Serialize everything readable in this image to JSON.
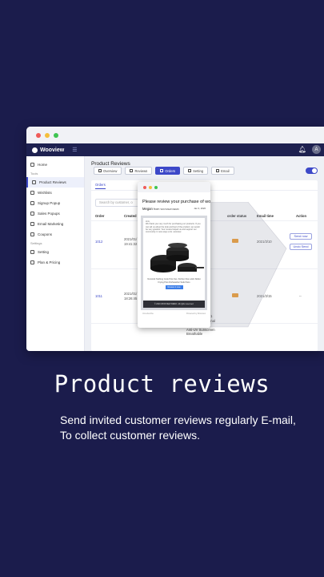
{
  "app": {
    "name": "Wooview",
    "page_title": "Product Reviews",
    "avatar_initial": "A"
  },
  "sidebar": {
    "items": [
      {
        "label": "Home",
        "icon": "home-icon"
      },
      {
        "label": "Product Reviews",
        "icon": "reviews-icon",
        "active": true
      },
      {
        "label": "Wishlists",
        "icon": "heart-icon"
      },
      {
        "label": "Signup Popup",
        "icon": "popup-icon"
      },
      {
        "label": "Sales Popups",
        "icon": "sales-icon"
      },
      {
        "label": "Email Marketing",
        "icon": "email-icon"
      },
      {
        "label": "Coupons",
        "icon": "coupon-icon"
      },
      {
        "label": "Setting",
        "icon": "gear-icon"
      },
      {
        "label": "Plan & Pricing",
        "icon": "plan-icon"
      }
    ],
    "group_tools": "Tools",
    "group_settings": "Settings"
  },
  "tabs": [
    "Overview",
    "Reviews",
    "Orders",
    "Setting",
    "Email"
  ],
  "subtab": "Orders",
  "search_placeholder": "Search by customer, o",
  "table": {
    "headers": {
      "order": "Order",
      "created": "Created",
      "status": "order status",
      "email": "Email time",
      "action": "Action"
    },
    "rows": [
      {
        "order": "1012",
        "created": "2021/01/\n19:41:32",
        "email_time": "2021/3/10",
        "actions": [
          "Send now",
          "Undo Send"
        ]
      },
      {
        "order": "1011",
        "created": "2021/01/\n18:26:45",
        "email_time": "2021/3/15",
        "actions": [
          "--"
        ]
      }
    ],
    "product_text": "Fine Green / L / 1\nDalwa Professional\nFishing Hoodie\nAnti-UV Sunscreen\nBreathable"
  },
  "popup": {
    "subject": "Please review your purchase of woovie...",
    "sender": "Megan",
    "from_label": "from",
    "store": "WOOVIEW DEMO",
    "date": "Jan 3, 2020",
    "greeting": "Hi A,",
    "body": "We thank you very much for purchasing our products. If you can tell us about the look and feel of the product, we would be very grateful. Your review helped us and support our community in new ways a lot. wooview",
    "product_caption": "Nonstick Nothing Cook Pots Set, Kitchen Non-stick Skillet Frying Pots Dishwasher Safe Pans",
    "button": "Review it now",
    "footer": "© 2020 WOOVIEW DEMO. All rights reserved.",
    "bottom_left": "Unsubscribe",
    "bottom_right": "Powered by Wooview"
  },
  "headline": "Product reviews",
  "description_line1": "Send invited customer reviews regularly E-mail,",
  "description_line2": "To collect customer reviews.",
  "colors": {
    "background": "#1b1c4c",
    "app_bar": "#1e2150",
    "accent": "#3c48c8",
    "status_badge": "#f0a13c"
  }
}
